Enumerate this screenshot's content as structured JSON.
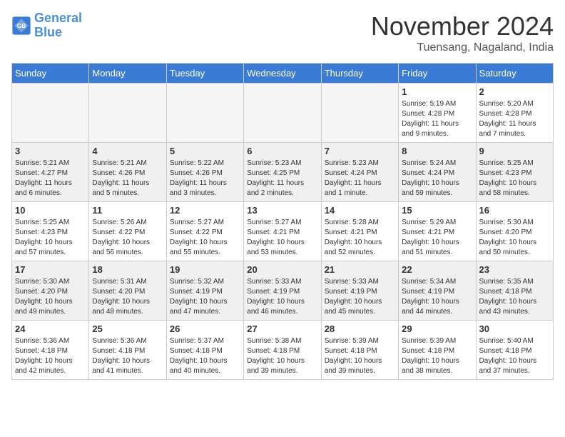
{
  "logo": {
    "text_general": "General",
    "text_blue": "Blue"
  },
  "header": {
    "month": "November 2024",
    "location": "Tuensang, Nagaland, India"
  },
  "weekdays": [
    "Sunday",
    "Monday",
    "Tuesday",
    "Wednesday",
    "Thursday",
    "Friday",
    "Saturday"
  ],
  "weeks": [
    {
      "shaded": false,
      "days": [
        {
          "num": "",
          "info": ""
        },
        {
          "num": "",
          "info": ""
        },
        {
          "num": "",
          "info": ""
        },
        {
          "num": "",
          "info": ""
        },
        {
          "num": "",
          "info": ""
        },
        {
          "num": "1",
          "info": "Sunrise: 5:19 AM\nSunset: 4:28 PM\nDaylight: 11 hours\nand 9 minutes."
        },
        {
          "num": "2",
          "info": "Sunrise: 5:20 AM\nSunset: 4:28 PM\nDaylight: 11 hours\nand 7 minutes."
        }
      ]
    },
    {
      "shaded": true,
      "days": [
        {
          "num": "3",
          "info": "Sunrise: 5:21 AM\nSunset: 4:27 PM\nDaylight: 11 hours\nand 6 minutes."
        },
        {
          "num": "4",
          "info": "Sunrise: 5:21 AM\nSunset: 4:26 PM\nDaylight: 11 hours\nand 5 minutes."
        },
        {
          "num": "5",
          "info": "Sunrise: 5:22 AM\nSunset: 4:26 PM\nDaylight: 11 hours\nand 3 minutes."
        },
        {
          "num": "6",
          "info": "Sunrise: 5:23 AM\nSunset: 4:25 PM\nDaylight: 11 hours\nand 2 minutes."
        },
        {
          "num": "7",
          "info": "Sunrise: 5:23 AM\nSunset: 4:24 PM\nDaylight: 11 hours\nand 1 minute."
        },
        {
          "num": "8",
          "info": "Sunrise: 5:24 AM\nSunset: 4:24 PM\nDaylight: 10 hours\nand 59 minutes."
        },
        {
          "num": "9",
          "info": "Sunrise: 5:25 AM\nSunset: 4:23 PM\nDaylight: 10 hours\nand 58 minutes."
        }
      ]
    },
    {
      "shaded": false,
      "days": [
        {
          "num": "10",
          "info": "Sunrise: 5:25 AM\nSunset: 4:23 PM\nDaylight: 10 hours\nand 57 minutes."
        },
        {
          "num": "11",
          "info": "Sunrise: 5:26 AM\nSunset: 4:22 PM\nDaylight: 10 hours\nand 56 minutes."
        },
        {
          "num": "12",
          "info": "Sunrise: 5:27 AM\nSunset: 4:22 PM\nDaylight: 10 hours\nand 55 minutes."
        },
        {
          "num": "13",
          "info": "Sunrise: 5:27 AM\nSunset: 4:21 PM\nDaylight: 10 hours\nand 53 minutes."
        },
        {
          "num": "14",
          "info": "Sunrise: 5:28 AM\nSunset: 4:21 PM\nDaylight: 10 hours\nand 52 minutes."
        },
        {
          "num": "15",
          "info": "Sunrise: 5:29 AM\nSunset: 4:21 PM\nDaylight: 10 hours\nand 51 minutes."
        },
        {
          "num": "16",
          "info": "Sunrise: 5:30 AM\nSunset: 4:20 PM\nDaylight: 10 hours\nand 50 minutes."
        }
      ]
    },
    {
      "shaded": true,
      "days": [
        {
          "num": "17",
          "info": "Sunrise: 5:30 AM\nSunset: 4:20 PM\nDaylight: 10 hours\nand 49 minutes."
        },
        {
          "num": "18",
          "info": "Sunrise: 5:31 AM\nSunset: 4:20 PM\nDaylight: 10 hours\nand 48 minutes."
        },
        {
          "num": "19",
          "info": "Sunrise: 5:32 AM\nSunset: 4:19 PM\nDaylight: 10 hours\nand 47 minutes."
        },
        {
          "num": "20",
          "info": "Sunrise: 5:33 AM\nSunset: 4:19 PM\nDaylight: 10 hours\nand 46 minutes."
        },
        {
          "num": "21",
          "info": "Sunrise: 5:33 AM\nSunset: 4:19 PM\nDaylight: 10 hours\nand 45 minutes."
        },
        {
          "num": "22",
          "info": "Sunrise: 5:34 AM\nSunset: 4:19 PM\nDaylight: 10 hours\nand 44 minutes."
        },
        {
          "num": "23",
          "info": "Sunrise: 5:35 AM\nSunset: 4:18 PM\nDaylight: 10 hours\nand 43 minutes."
        }
      ]
    },
    {
      "shaded": false,
      "days": [
        {
          "num": "24",
          "info": "Sunrise: 5:36 AM\nSunset: 4:18 PM\nDaylight: 10 hours\nand 42 minutes."
        },
        {
          "num": "25",
          "info": "Sunrise: 5:36 AM\nSunset: 4:18 PM\nDaylight: 10 hours\nand 41 minutes."
        },
        {
          "num": "26",
          "info": "Sunrise: 5:37 AM\nSunset: 4:18 PM\nDaylight: 10 hours\nand 40 minutes."
        },
        {
          "num": "27",
          "info": "Sunrise: 5:38 AM\nSunset: 4:18 PM\nDaylight: 10 hours\nand 39 minutes."
        },
        {
          "num": "28",
          "info": "Sunrise: 5:39 AM\nSunset: 4:18 PM\nDaylight: 10 hours\nand 39 minutes."
        },
        {
          "num": "29",
          "info": "Sunrise: 5:39 AM\nSunset: 4:18 PM\nDaylight: 10 hours\nand 38 minutes."
        },
        {
          "num": "30",
          "info": "Sunrise: 5:40 AM\nSunset: 4:18 PM\nDaylight: 10 hours\nand 37 minutes."
        }
      ]
    }
  ]
}
